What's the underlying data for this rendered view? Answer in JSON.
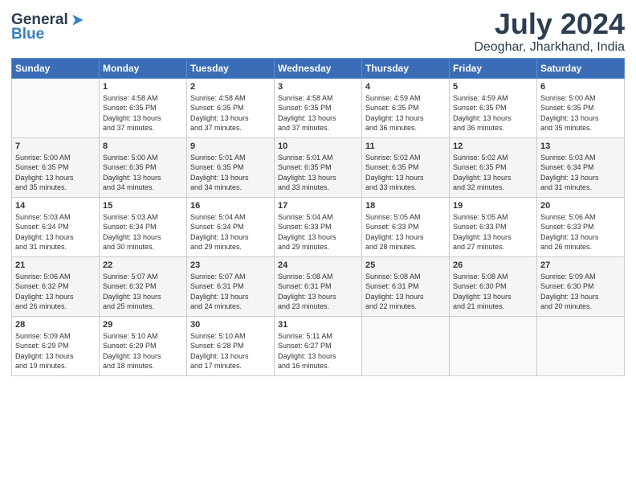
{
  "header": {
    "logo_line1": "General",
    "logo_line2": "Blue",
    "month_year": "July 2024",
    "location": "Deoghar, Jharkhand, India"
  },
  "days_of_week": [
    "Sunday",
    "Monday",
    "Tuesday",
    "Wednesday",
    "Thursday",
    "Friday",
    "Saturday"
  ],
  "weeks": [
    [
      {
        "day": "",
        "info": ""
      },
      {
        "day": "1",
        "info": "Sunrise: 4:58 AM\nSunset: 6:35 PM\nDaylight: 13 hours\nand 37 minutes."
      },
      {
        "day": "2",
        "info": "Sunrise: 4:58 AM\nSunset: 6:35 PM\nDaylight: 13 hours\nand 37 minutes."
      },
      {
        "day": "3",
        "info": "Sunrise: 4:58 AM\nSunset: 6:35 PM\nDaylight: 13 hours\nand 37 minutes."
      },
      {
        "day": "4",
        "info": "Sunrise: 4:59 AM\nSunset: 6:35 PM\nDaylight: 13 hours\nand 36 minutes."
      },
      {
        "day": "5",
        "info": "Sunrise: 4:59 AM\nSunset: 6:35 PM\nDaylight: 13 hours\nand 36 minutes."
      },
      {
        "day": "6",
        "info": "Sunrise: 5:00 AM\nSunset: 6:35 PM\nDaylight: 13 hours\nand 35 minutes."
      }
    ],
    [
      {
        "day": "7",
        "info": "Sunrise: 5:00 AM\nSunset: 6:35 PM\nDaylight: 13 hours\nand 35 minutes."
      },
      {
        "day": "8",
        "info": "Sunrise: 5:00 AM\nSunset: 6:35 PM\nDaylight: 13 hours\nand 34 minutes."
      },
      {
        "day": "9",
        "info": "Sunrise: 5:01 AM\nSunset: 6:35 PM\nDaylight: 13 hours\nand 34 minutes."
      },
      {
        "day": "10",
        "info": "Sunrise: 5:01 AM\nSunset: 6:35 PM\nDaylight: 13 hours\nand 33 minutes."
      },
      {
        "day": "11",
        "info": "Sunrise: 5:02 AM\nSunset: 6:35 PM\nDaylight: 13 hours\nand 33 minutes."
      },
      {
        "day": "12",
        "info": "Sunrise: 5:02 AM\nSunset: 6:35 PM\nDaylight: 13 hours\nand 32 minutes."
      },
      {
        "day": "13",
        "info": "Sunrise: 5:03 AM\nSunset: 6:34 PM\nDaylight: 13 hours\nand 31 minutes."
      }
    ],
    [
      {
        "day": "14",
        "info": "Sunrise: 5:03 AM\nSunset: 6:34 PM\nDaylight: 13 hours\nand 31 minutes."
      },
      {
        "day": "15",
        "info": "Sunrise: 5:03 AM\nSunset: 6:34 PM\nDaylight: 13 hours\nand 30 minutes."
      },
      {
        "day": "16",
        "info": "Sunrise: 5:04 AM\nSunset: 6:34 PM\nDaylight: 13 hours\nand 29 minutes."
      },
      {
        "day": "17",
        "info": "Sunrise: 5:04 AM\nSunset: 6:33 PM\nDaylight: 13 hours\nand 29 minutes."
      },
      {
        "day": "18",
        "info": "Sunrise: 5:05 AM\nSunset: 6:33 PM\nDaylight: 13 hours\nand 28 minutes."
      },
      {
        "day": "19",
        "info": "Sunrise: 5:05 AM\nSunset: 6:33 PM\nDaylight: 13 hours\nand 27 minutes."
      },
      {
        "day": "20",
        "info": "Sunrise: 5:06 AM\nSunset: 6:33 PM\nDaylight: 13 hours\nand 26 minutes."
      }
    ],
    [
      {
        "day": "21",
        "info": "Sunrise: 5:06 AM\nSunset: 6:32 PM\nDaylight: 13 hours\nand 26 minutes."
      },
      {
        "day": "22",
        "info": "Sunrise: 5:07 AM\nSunset: 6:32 PM\nDaylight: 13 hours\nand 25 minutes."
      },
      {
        "day": "23",
        "info": "Sunrise: 5:07 AM\nSunset: 6:31 PM\nDaylight: 13 hours\nand 24 minutes."
      },
      {
        "day": "24",
        "info": "Sunrise: 5:08 AM\nSunset: 6:31 PM\nDaylight: 13 hours\nand 23 minutes."
      },
      {
        "day": "25",
        "info": "Sunrise: 5:08 AM\nSunset: 6:31 PM\nDaylight: 13 hours\nand 22 minutes."
      },
      {
        "day": "26",
        "info": "Sunrise: 5:08 AM\nSunset: 6:30 PM\nDaylight: 13 hours\nand 21 minutes."
      },
      {
        "day": "27",
        "info": "Sunrise: 5:09 AM\nSunset: 6:30 PM\nDaylight: 13 hours\nand 20 minutes."
      }
    ],
    [
      {
        "day": "28",
        "info": "Sunrise: 5:09 AM\nSunset: 6:29 PM\nDaylight: 13 hours\nand 19 minutes."
      },
      {
        "day": "29",
        "info": "Sunrise: 5:10 AM\nSunset: 6:29 PM\nDaylight: 13 hours\nand 18 minutes."
      },
      {
        "day": "30",
        "info": "Sunrise: 5:10 AM\nSunset: 6:28 PM\nDaylight: 13 hours\nand 17 minutes."
      },
      {
        "day": "31",
        "info": "Sunrise: 5:11 AM\nSunset: 6:27 PM\nDaylight: 13 hours\nand 16 minutes."
      },
      {
        "day": "",
        "info": ""
      },
      {
        "day": "",
        "info": ""
      },
      {
        "day": "",
        "info": ""
      }
    ]
  ]
}
